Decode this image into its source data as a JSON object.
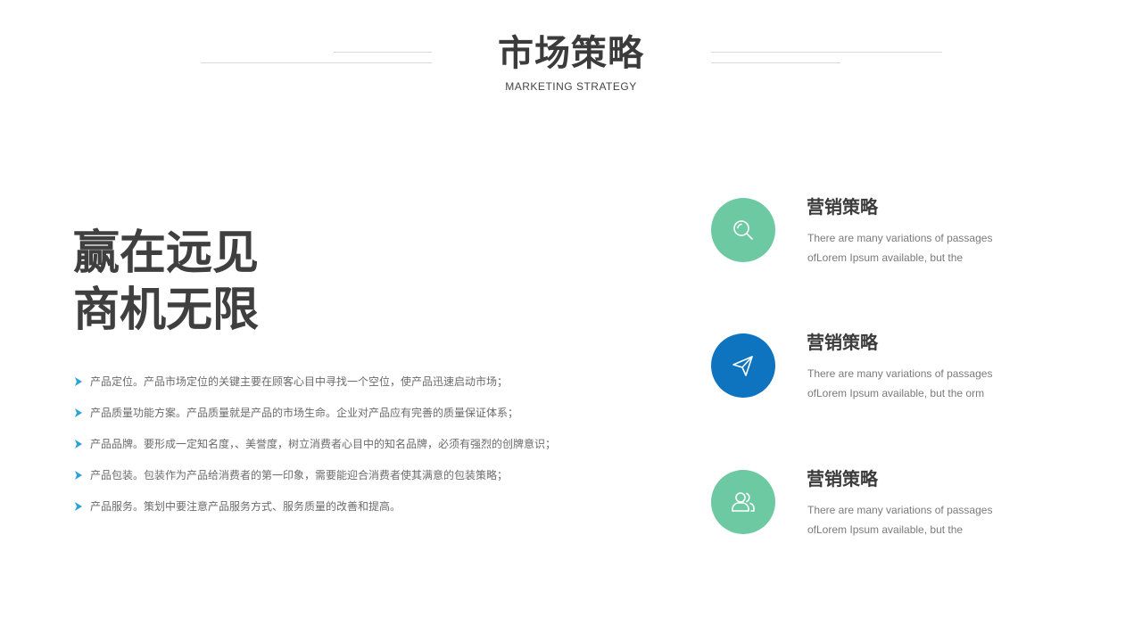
{
  "header": {
    "title": "市场策略",
    "subtitle": "MARKETING  STRATEGY"
  },
  "slogan": {
    "line1": "赢在远见",
    "line2": "商机无限"
  },
  "bullets": [
    "产品定位。产品市场定位的关键主要在顾客心目中寻找一个空位，使产品迅速启动市场；",
    "产品质量功能方案。产品质量就是产品的市场生命。企业对产品应有完善的质量保证体系；",
    "产品品牌。要形成一定知名度，、美誉度，树立消费者心目中的知名品牌，必须有强烈的创牌意识；",
    "产品包装。包装作为产品给消费者的第一印象，需要能迎合消费者使其满意的包装策略；",
    "产品服务。策划中要注意产品服务方式、服务质量的改善和提高。"
  ],
  "features": [
    {
      "icon": "search-icon",
      "color": "#6CC9A1",
      "title": "营销策略",
      "desc_line1": "There are many variations of passages",
      "desc_line2": "ofLorem Ipsum available, but the"
    },
    {
      "icon": "paper-plane-icon",
      "color": "#0E74BF",
      "title": "营销策略",
      "desc_line1": "There are many variations of passages",
      "desc_line2": "ofLorem Ipsum available, but the orm"
    },
    {
      "icon": "users-icon",
      "color": "#6CC9A1",
      "title": "营销策略",
      "desc_line1": "There are many variations of passages",
      "desc_line2": "ofLorem Ipsum available, but the"
    }
  ],
  "colors": {
    "accent_blue": "#0E74BF",
    "accent_green": "#6CC9A1",
    "bullet_arrow": "#2AA3D8"
  }
}
